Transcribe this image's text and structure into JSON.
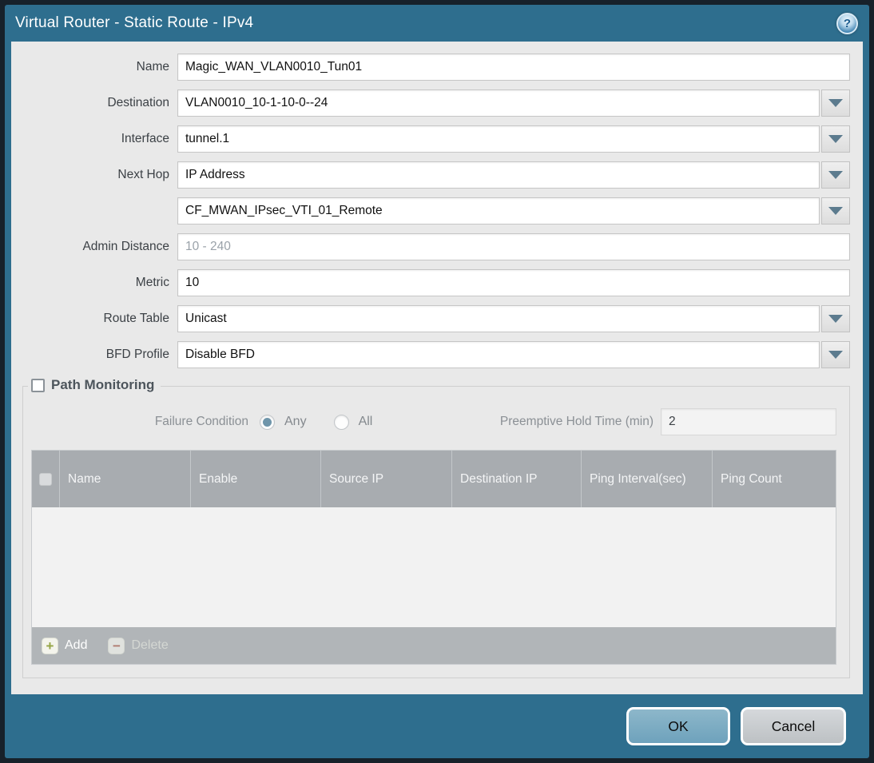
{
  "dialog": {
    "title": "Virtual Router - Static Route - IPv4",
    "help_glyph": "?"
  },
  "form": {
    "fields": [
      {
        "label": "Name",
        "value": "Magic_WAN_VLAN0010_Tun01"
      },
      {
        "label": "Destination",
        "value": "VLAN0010_10-1-10-0--24"
      },
      {
        "label": "Interface",
        "value": "tunnel.1"
      },
      {
        "label": "Next Hop",
        "value": "IP Address"
      },
      {
        "label": "",
        "value": "CF_MWAN_IPsec_VTI_01_Remote"
      },
      {
        "label": "Admin Distance",
        "value": "",
        "placeholder": "10 - 240"
      },
      {
        "label": "Metric",
        "value": "10"
      },
      {
        "label": "Route Table",
        "value": "Unicast"
      },
      {
        "label": "BFD Profile",
        "value": "Disable BFD"
      }
    ]
  },
  "path_monitoring": {
    "legend": "Path Monitoring",
    "checkbox_checked": false,
    "failure_condition": {
      "label": "Failure Condition",
      "options": [
        {
          "label": "Any",
          "selected": true
        },
        {
          "label": "All",
          "selected": false
        }
      ]
    },
    "preemptive_hold_time": {
      "label": "Preemptive Hold Time (min)",
      "value": "2"
    },
    "table": {
      "headers": [
        "Name",
        "Enable",
        "Source IP",
        "Destination IP",
        "Ping Interval(sec)",
        "Ping Count"
      ],
      "rows": []
    },
    "toolbar": {
      "add_label": "Add",
      "add_glyph": "+",
      "delete_label": "Delete",
      "delete_glyph": "−",
      "delete_enabled": false
    }
  },
  "footer": {
    "ok_label": "OK",
    "cancel_label": "Cancel"
  },
  "colors": {
    "titlebar": "#2e6e8e",
    "content_bg": "#e9e9e9",
    "table_header_bg": "#a8acb0",
    "table_footer_bg": "#b1b5b8",
    "ok_button": "#7fadc4",
    "cancel_button": "#c9cdd0",
    "radio_selected": "#6f95aa",
    "add_icon_green": "#95a545",
    "delete_icon_red": "#b07a6e",
    "outer_border": "#17212a"
  }
}
